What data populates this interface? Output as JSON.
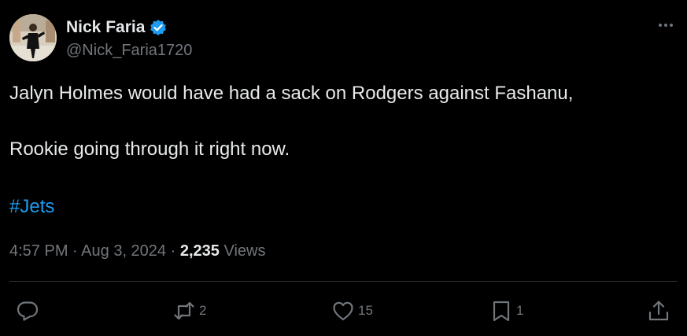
{
  "author": {
    "display_name": "Nick Faria",
    "handle": "@Nick_Faria1720",
    "verified": true
  },
  "tweet": {
    "lines": [
      "Jalyn Holmes would have had a sack on Rodgers against Fashanu,",
      "Rookie going through it right now."
    ],
    "hashtag": "#Jets"
  },
  "meta": {
    "time": "4:57 PM",
    "separator1": "·",
    "date": "Aug 3, 2024",
    "separator2": "·",
    "views_count": "2,235",
    "views_label": "Views"
  },
  "actions": {
    "reply_count": "",
    "retweet_count": "2",
    "like_count": "15",
    "bookmark_count": "1"
  },
  "icons": {
    "more": "more-horizontal-icon",
    "reply": "reply-icon",
    "retweet": "retweet-icon",
    "like": "heart-icon",
    "bookmark": "bookmark-icon",
    "share": "share-icon",
    "verified": "verified-badge-icon"
  },
  "colors": {
    "background": "#000000",
    "text": "#e7e9ea",
    "muted": "#71767b",
    "link": "#1d9bf0",
    "divider": "#2f3336"
  }
}
